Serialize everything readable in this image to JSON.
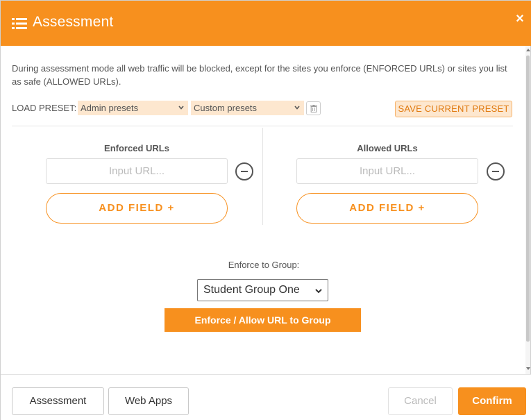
{
  "header": {
    "title": "Assessment",
    "close_symbol": "×",
    "icon": "list-icon"
  },
  "description": "During assessment mode all web traffic will be blocked, except for the sites you enforce (ENFORCED URLs) or sites you list as safe (ALLOWED URLs).",
  "presets": {
    "label": "LOAD PRESET:",
    "admin_selected": "Admin presets",
    "custom_selected": "Custom presets",
    "save_label": "SAVE CURRENT PRESET"
  },
  "enforced": {
    "title": "Enforced URLs",
    "placeholder": "Input URL...",
    "add_label": "ADD FIELD +"
  },
  "allowed": {
    "title": "Allowed URLs",
    "placeholder": "Input URL...",
    "add_label": "ADD FIELD +"
  },
  "group": {
    "label": "Enforce to Group:",
    "selected": "Student Group One",
    "button_label": "Enforce / Allow URL to Group"
  },
  "footer": {
    "assessment_label": "Assessment",
    "webapps_label": "Web Apps",
    "cancel_label": "Cancel",
    "confirm_label": "Confirm"
  },
  "colors": {
    "accent": "#f7901e",
    "accent_light": "#fde7cf",
    "text": "#555555"
  }
}
